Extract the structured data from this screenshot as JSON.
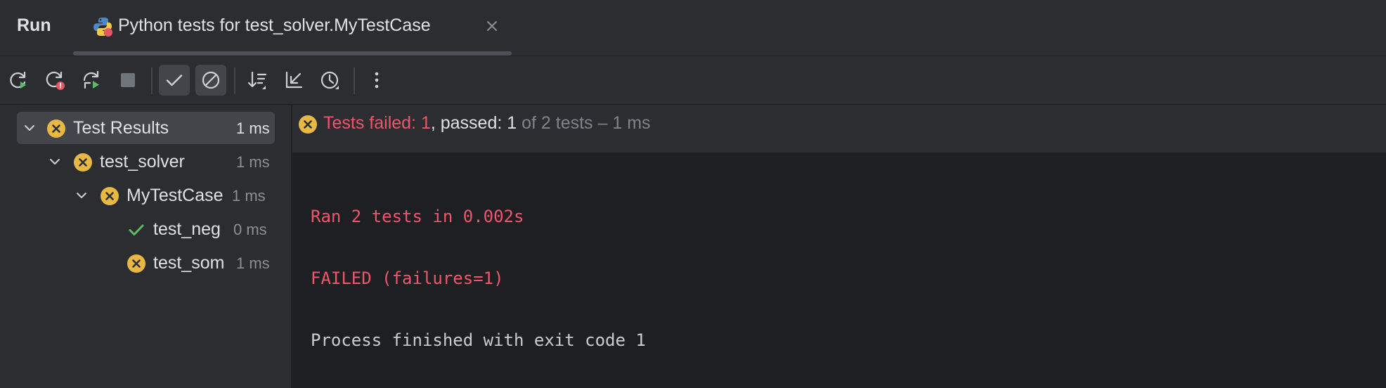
{
  "header": {
    "run_label": "Run",
    "tab": {
      "title": "Python tests for test_solver.MyTestCase",
      "icon": "python-icon"
    }
  },
  "toolbar": {
    "buttons": [
      "rerun-icon",
      "rerun-failed-icon",
      "toggle-auto-test-icon",
      "stop-icon",
      "show-passed-icon",
      "show-ignored-icon",
      "sort-icon",
      "collapse-icon",
      "test-history-icon",
      "more-icon"
    ],
    "active": [
      "show-passed-icon",
      "show-ignored-icon"
    ]
  },
  "tree": {
    "items": [
      {
        "label": "Test Results",
        "time": "1 ms",
        "status": "failed",
        "level": 0
      },
      {
        "label": "test_solver",
        "time": "1 ms",
        "status": "failed",
        "level": 1
      },
      {
        "label": "MyTestCase",
        "time": "1 ms",
        "status": "failed",
        "level": 2
      },
      {
        "label": "test_neg",
        "time": "0 ms",
        "status": "passed",
        "level": 3
      },
      {
        "label": "test_som",
        "time": "1 ms",
        "status": "failed",
        "level": 3
      }
    ]
  },
  "status": {
    "failed_label": "Tests failed: ",
    "failed_count": "1",
    "passed_label": ", passed: ",
    "passed_count": "1",
    "summary": " of 2 tests – 1 ms"
  },
  "console": {
    "line1": "Ran 2 tests in 0.002s",
    "line2": "FAILED (failures=1)",
    "line3": "Process finished with exit code 1"
  },
  "colors": {
    "failed": "#e8b845",
    "passed": "#5fb865",
    "error_text": "#f0566b",
    "accent_red": "#e55765"
  }
}
